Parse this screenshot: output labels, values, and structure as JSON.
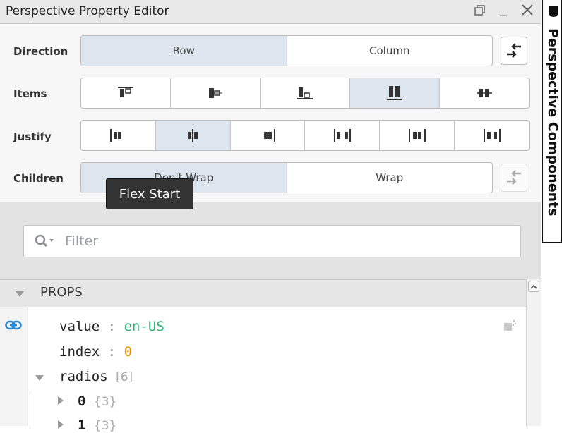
{
  "window": {
    "title": "Perspective Property Editor"
  },
  "direction": {
    "label": "Direction",
    "options": [
      "Row",
      "Column"
    ],
    "selected": "Row"
  },
  "items": {
    "label": "Items",
    "selected": "stretch"
  },
  "justify": {
    "label": "Justify",
    "selected": "center"
  },
  "children": {
    "label": "Children",
    "options": [
      "Don't Wrap",
      "Wrap"
    ],
    "selected": "Don't Wrap"
  },
  "tooltip": {
    "text": "Flex Start"
  },
  "filter": {
    "placeholder": "Filter"
  },
  "props": {
    "title": "PROPS",
    "rows": [
      {
        "key": "value",
        "sep": ":",
        "value": "en-US"
      },
      {
        "key": "index",
        "sep": ":",
        "value": "0"
      },
      {
        "key": "radios",
        "count": "[6]"
      },
      {
        "key": "0",
        "count": "{3}"
      },
      {
        "key": "1",
        "count": "{3}"
      }
    ]
  },
  "side_panel": {
    "title": "Perspective Components"
  },
  "colors": {
    "selected": "#dde6ee",
    "value_green": "#2bb673",
    "value_orange": "#f29100",
    "link_blue": "#2a8ad4"
  }
}
